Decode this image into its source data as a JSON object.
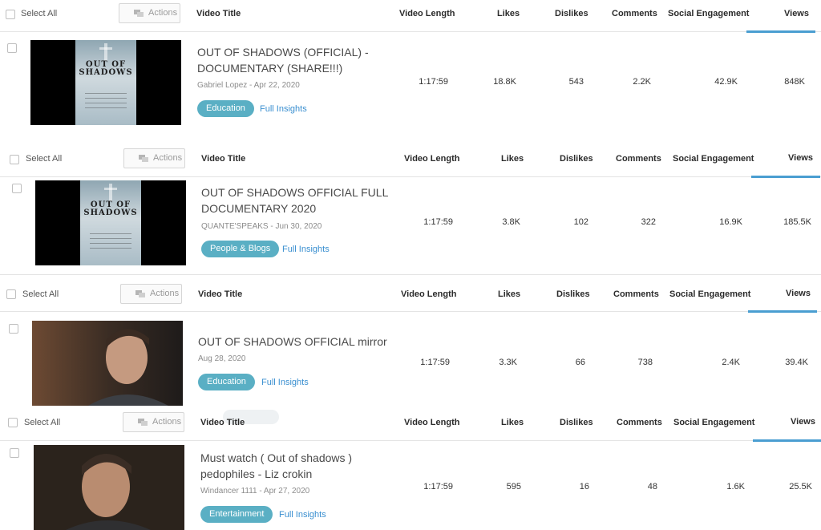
{
  "header": {
    "select_all": "Select All",
    "actions": "Actions",
    "video_title": "Video Title",
    "video_length": "Video Length",
    "likes": "Likes",
    "dislikes": "Dislikes",
    "comments": "Comments",
    "social_engagement": "Social Engagement",
    "views": "Views"
  },
  "accent_color": "#4a9ed1",
  "pill_color": "#5aafc4",
  "link_color": "#3a8fd0",
  "videos": [
    {
      "title": "OUT OF SHADOWS (OFFICIAL) - DOCUMENTARY (SHARE!!!)",
      "meta": "Gabriel Lopez - Apr 22, 2020",
      "category": "Education",
      "insights": "Full Insights",
      "length": "1:17:59",
      "likes": "18.8K",
      "dislikes": "543",
      "comments": "2.2K",
      "social": "42.9K",
      "views": "848K",
      "thumb_text": "OUT OF SHADOWS"
    },
    {
      "title": "OUT OF SHADOWS OFFICIAL FULL DOCUMENTARY 2020",
      "meta": "QUANTE'SPEAKS - Jun 30, 2020",
      "category": "People & Blogs",
      "insights": "Full Insights",
      "length": "1:17:59",
      "likes": "3.8K",
      "dislikes": "102",
      "comments": "322",
      "social": "16.9K",
      "views": "185.5K",
      "thumb_text": "OUT OF SHADOWS"
    },
    {
      "title": "OUT OF SHADOWS OFFICIAL mirror",
      "meta": "Aug 28, 2020",
      "category": "Education",
      "insights": "Full Insights",
      "length": "1:17:59",
      "likes": "3.3K",
      "dislikes": "66",
      "comments": "738",
      "social": "2.4K",
      "views": "39.4K"
    },
    {
      "title": "Must watch ( Out of shadows ) pedophiles - Liz crokin",
      "meta": "Windancer 1111 - Apr 27, 2020",
      "category": "Entertainment",
      "insights": "Full Insights",
      "length": "1:17:59",
      "likes": "595",
      "dislikes": "16",
      "comments": "48",
      "social": "1.6K",
      "views": "25.5K"
    }
  ]
}
